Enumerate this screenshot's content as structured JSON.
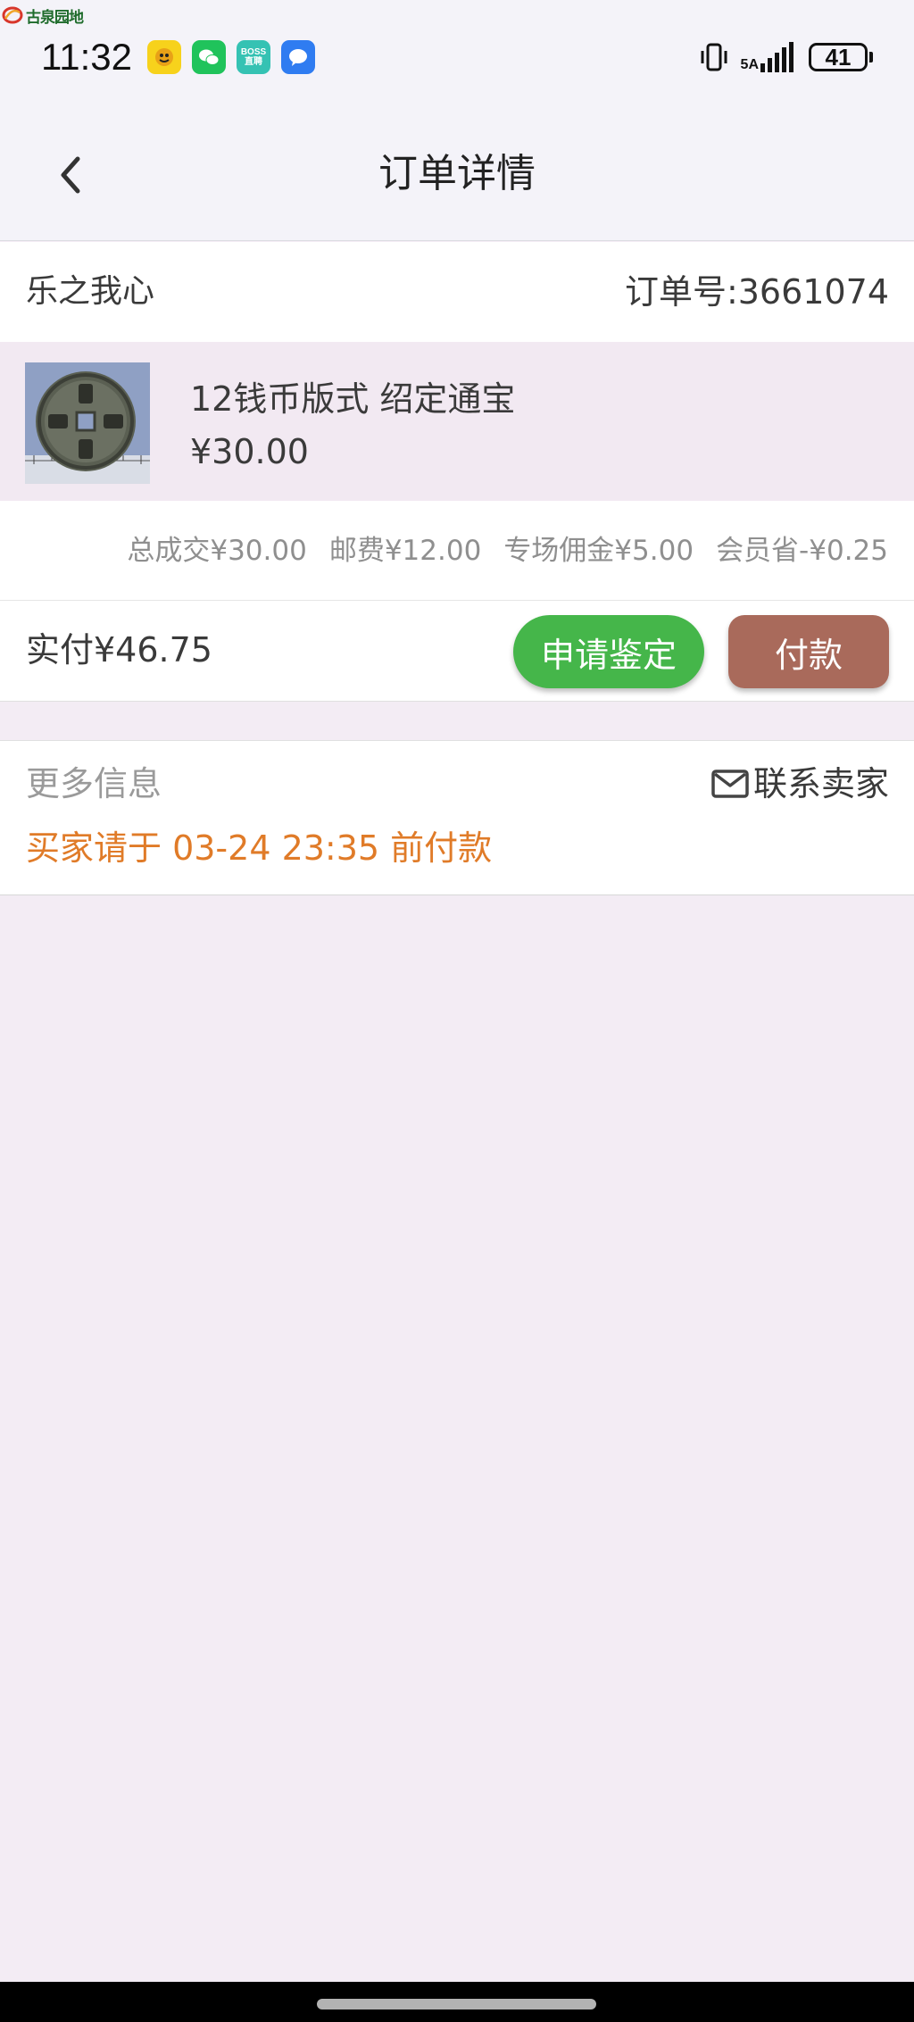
{
  "watermark": {
    "text": "古泉园地"
  },
  "status_bar": {
    "time": "11:32",
    "network": "5A",
    "battery_level": "41",
    "battery_fraction": 0.41,
    "icons": [
      "dog-app-icon",
      "wechat-icon",
      "boss-zhipin-icon",
      "message-icon",
      "vibrate-icon",
      "signal-icon",
      "battery-icon"
    ],
    "boss_icon_text": [
      "BOSS",
      "直聘"
    ]
  },
  "header": {
    "title": "订单详情",
    "back_icon": "chevron-left-icon"
  },
  "order": {
    "seller": "乐之我心",
    "order_number": "订单号:3661074"
  },
  "product": {
    "name": "12钱币版式 绍定通宝",
    "price": "¥30.00",
    "thumb_icon": "coin-thumbnail-image"
  },
  "fees": [
    "总成交¥30.00",
    "邮费¥12.00",
    "专场佣金¥5.00",
    "会员省-¥0.25"
  ],
  "payment": {
    "paid": "实付¥46.75",
    "appraise_label": "申请鉴定",
    "pay_label": "付款"
  },
  "more_info": {
    "title": "更多信息",
    "contact_label": "联系卖家",
    "contact_icon": "mail-icon",
    "deadline": "买家请于 03-24 23:35 前付款"
  },
  "colors": {
    "appraise_green": "#45b64a",
    "pay_brown": "#a96a5b",
    "deadline_orange": "#e07b28",
    "page_bg": "#f3ecf4"
  }
}
